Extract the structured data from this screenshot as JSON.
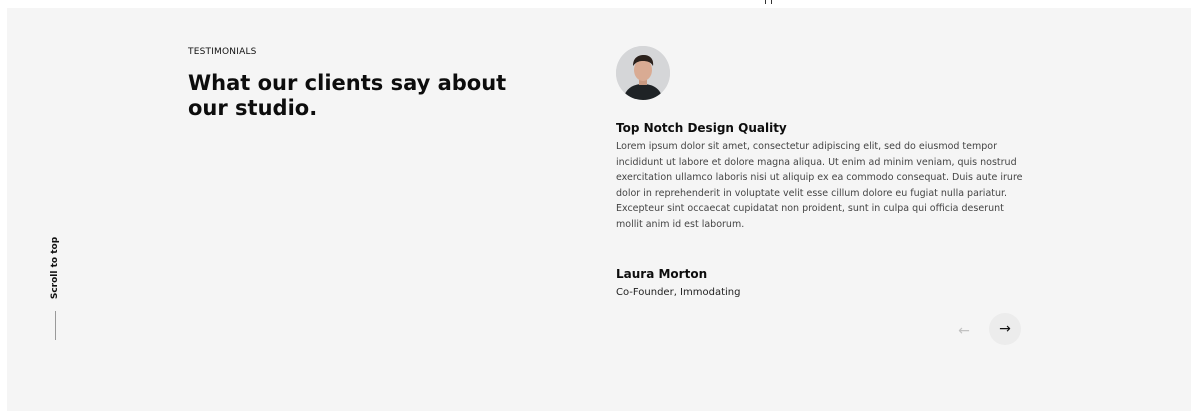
{
  "section": {
    "eyebrow": "TESTIMONIALS",
    "heading": "What our clients say about our studio."
  },
  "scroll_to_top": {
    "label": "Scroll to top"
  },
  "testimonial": {
    "avatar_icon": "person-avatar",
    "title": "Top Notch Design Quality",
    "body": "Lorem ipsum dolor sit amet, consectetur adipiscing elit, sed do eiusmod tempor incididunt ut labore et dolore magna aliqua. Ut enim ad minim veniam, quis nostrud exercitation ullamco laboris nisi ut aliquip ex ea commodo consequat. Duis aute irure dolor in reprehenderit in voluptate velit esse cillum dolore eu fugiat nulla pariatur. Excepteur sint occaecat cupidatat non proident, sunt in culpa qui officia deserunt mollit anim id est laborum.",
    "author": "Laura Morton",
    "role": "Co-Founder, Immodating"
  },
  "navigation": {
    "prev_icon": "←",
    "next_icon": "→"
  },
  "colors": {
    "background": "#f5f5f5",
    "text_dark": "#0d0d0d",
    "text_body": "#444444"
  }
}
